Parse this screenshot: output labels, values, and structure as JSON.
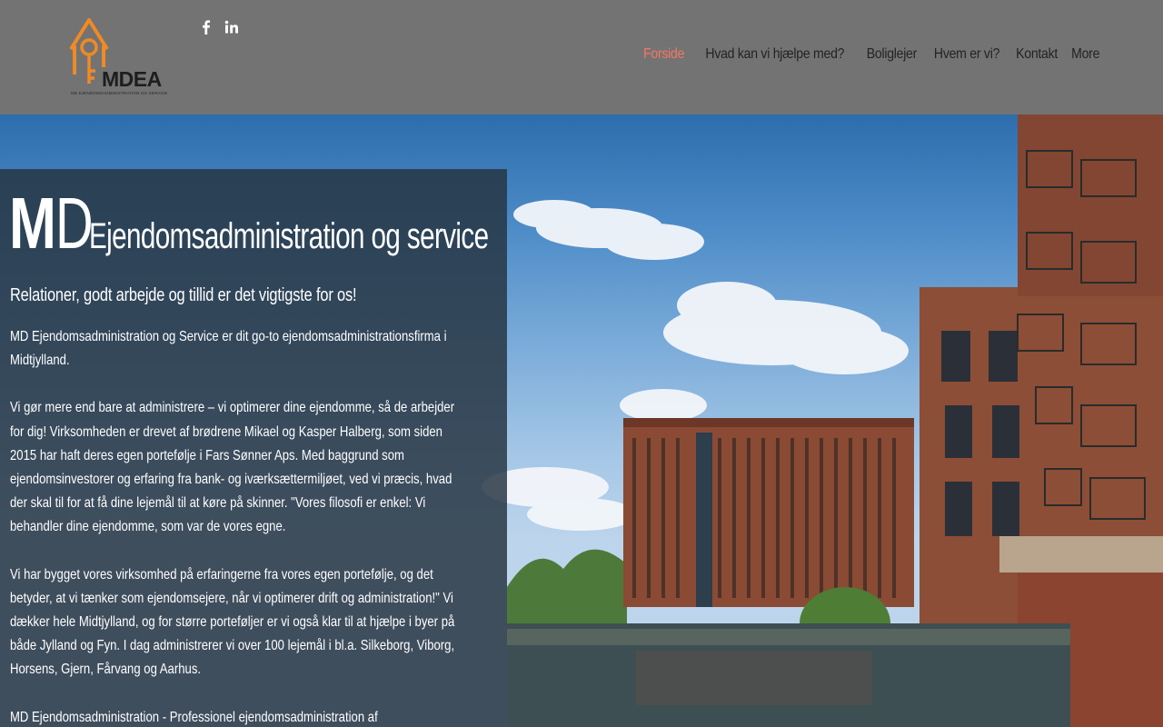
{
  "header": {
    "logo": {
      "wordmark": "MDEA",
      "subtitle": "MD EJENDOMSADMINISTRATION OG SERVICE",
      "icon": "house-key-icon",
      "accent_color": "#f08a24"
    },
    "social": [
      {
        "icon": "facebook-icon"
      },
      {
        "icon": "linkedin-icon"
      }
    ],
    "nav": {
      "items": [
        {
          "label": "Forside",
          "active": true
        },
        {
          "label": "Hvad kan vi hjælpe med?"
        },
        {
          "label": "Boliglejer"
        },
        {
          "label": "Hvem er vi?"
        },
        {
          "label": "Kontakt"
        },
        {
          "label": "More"
        }
      ],
      "active_color": "#f47763",
      "text_color": "#232323"
    }
  },
  "hero": {
    "brand_m": "M",
    "brand_d": "D",
    "brand_rest": "Ejendomsadministration og service",
    "tagline": "Relationer, godt arbejde og tillid er det vigtigste for os!",
    "paragraphs": [
      "MD Ejendomsadministration og Service er dit go-to ejendomsadministrationsfirma i Midtjylland.",
      "Vi gør mere end bare at administrere – vi optimerer dine ejendomme, så de arbejder for dig! Virksomheden er drevet af brødrene Mikael og Kasper Halberg, som siden 2015 har haft deres egen portefølje i Fars Sønner Aps. Med baggrund som ejendomsinvestorer og erfaring fra bank- og iværksættermiljøet, ved vi præcis, hvad der skal til for at få dine lejemål til at køre på skinner. \"Vores filosofi er enkel: Vi behandler dine ejendomme, som var de vores egne.",
      "Vi har bygget vores virksomhed på erfaringerne fra vores egen portefølje, og det betyder, at vi tænker som ejendomsejere, når vi optimerer drift og administration!\" Vi dækker hele Midtjylland, og for større porteføljer er vi også klar til at hjælpe i byer på både Jylland og Fyn. I dag administrerer vi over 100 lejemål i bl.a. Silkeborg, Viborg, Horsens, Gjern, Fårvang og Aarhus.",
      "MD Ejendomsadministration - Professionel ejendomsadministration af"
    ],
    "panel_color": "#263442"
  }
}
